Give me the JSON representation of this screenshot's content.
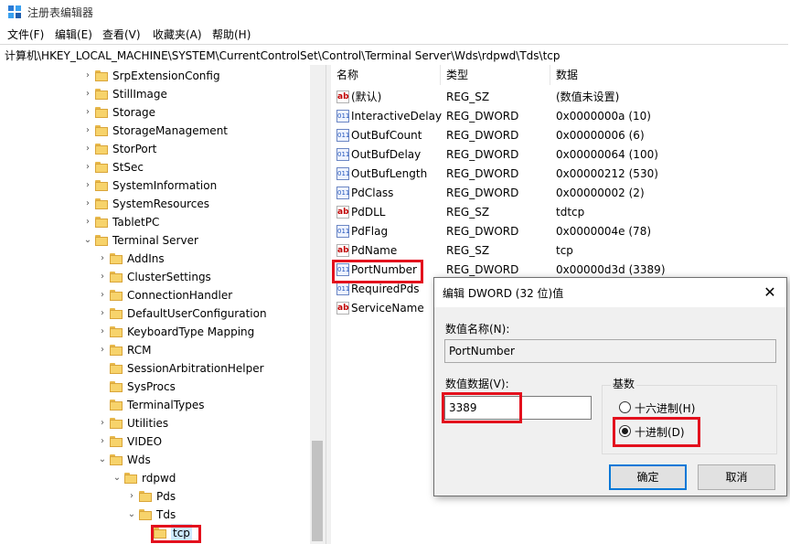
{
  "window": {
    "title": "注册表编辑器",
    "app_icon": "regedit-icon"
  },
  "menu": [
    "文件(F)",
    "编辑(E)",
    "查看(V)",
    "收藏夹(A)",
    "帮助(H)"
  ],
  "address": "计算机\\HKEY_LOCAL_MACHINE\\SYSTEM\\CurrentControlSet\\Control\\Terminal Server\\Wds\\rdpwd\\Tds\\tcp",
  "tree": [
    {
      "label": "SrpExtensionConfig",
      "level": 0,
      "expand": "collapsed"
    },
    {
      "label": "StillImage",
      "level": 0,
      "expand": "collapsed"
    },
    {
      "label": "Storage",
      "level": 0,
      "expand": "collapsed"
    },
    {
      "label": "StorageManagement",
      "level": 0,
      "expand": "collapsed"
    },
    {
      "label": "StorPort",
      "level": 0,
      "expand": "collapsed"
    },
    {
      "label": "StSec",
      "level": 0,
      "expand": "collapsed"
    },
    {
      "label": "SystemInformation",
      "level": 0,
      "expand": "collapsed"
    },
    {
      "label": "SystemResources",
      "level": 0,
      "expand": "collapsed"
    },
    {
      "label": "TabletPC",
      "level": 0,
      "expand": "collapsed"
    },
    {
      "label": "Terminal Server",
      "level": 0,
      "expand": "expanded"
    },
    {
      "label": "AddIns",
      "level": 1,
      "expand": "collapsed"
    },
    {
      "label": "ClusterSettings",
      "level": 1,
      "expand": "collapsed"
    },
    {
      "label": "ConnectionHandler",
      "level": 1,
      "expand": "collapsed"
    },
    {
      "label": "DefaultUserConfiguration",
      "level": 1,
      "expand": "collapsed"
    },
    {
      "label": "KeyboardType Mapping",
      "level": 1,
      "expand": "collapsed"
    },
    {
      "label": "RCM",
      "level": 1,
      "expand": "collapsed"
    },
    {
      "label": "SessionArbitrationHelper",
      "level": 1,
      "expand": "none"
    },
    {
      "label": "SysProcs",
      "level": 1,
      "expand": "none"
    },
    {
      "label": "TerminalTypes",
      "level": 1,
      "expand": "none"
    },
    {
      "label": "Utilities",
      "level": 1,
      "expand": "collapsed"
    },
    {
      "label": "VIDEO",
      "level": 1,
      "expand": "collapsed"
    },
    {
      "label": "Wds",
      "level": 1,
      "expand": "expanded"
    },
    {
      "label": "rdpwd",
      "level": 2,
      "expand": "expanded"
    },
    {
      "label": "Pds",
      "level": 3,
      "expand": "collapsed"
    },
    {
      "label": "Tds",
      "level": 3,
      "expand": "expanded"
    },
    {
      "label": "tcp",
      "level": 4,
      "expand": "none",
      "selected": true
    }
  ],
  "list": {
    "headers": {
      "name": "名称",
      "type": "类型",
      "data": "数据"
    },
    "rows": [
      {
        "name": "(默认)",
        "type": "REG_SZ",
        "data": "(数值未设置)",
        "icon": "string-value-icon"
      },
      {
        "name": "InteractiveDelay",
        "type": "REG_DWORD",
        "data": "0x0000000a (10)",
        "icon": "dword-value-icon"
      },
      {
        "name": "OutBufCount",
        "type": "REG_DWORD",
        "data": "0x00000006 (6)",
        "icon": "dword-value-icon"
      },
      {
        "name": "OutBufDelay",
        "type": "REG_DWORD",
        "data": "0x00000064 (100)",
        "icon": "dword-value-icon"
      },
      {
        "name": "OutBufLength",
        "type": "REG_DWORD",
        "data": "0x00000212 (530)",
        "icon": "dword-value-icon"
      },
      {
        "name": "PdClass",
        "type": "REG_DWORD",
        "data": "0x00000002 (2)",
        "icon": "dword-value-icon"
      },
      {
        "name": "PdDLL",
        "type": "REG_SZ",
        "data": "tdtcp",
        "icon": "string-value-icon"
      },
      {
        "name": "PdFlag",
        "type": "REG_DWORD",
        "data": "0x0000004e (78)",
        "icon": "dword-value-icon"
      },
      {
        "name": "PdName",
        "type": "REG_SZ",
        "data": "tcp",
        "icon": "string-value-icon"
      },
      {
        "name": "PortNumber",
        "type": "REG_DWORD",
        "data": "0x00000d3d (3389)",
        "icon": "dword-value-icon"
      },
      {
        "name": "RequiredPds",
        "type": "",
        "data": "",
        "icon": "dword-value-icon"
      },
      {
        "name": "ServiceName",
        "type": "",
        "data": "",
        "icon": "string-value-icon"
      }
    ]
  },
  "dialog": {
    "title": "编辑 DWORD (32 位)值",
    "name_label": "数值名称(N):",
    "name_value": "PortNumber",
    "data_label": "数值数据(V):",
    "data_value": "3389",
    "base_label": "基数",
    "hex_label": "十六进制(H)",
    "dec_label": "十进制(D)",
    "selected_base": "decimal",
    "ok_label": "确定",
    "cancel_label": "取消"
  },
  "highlight_color": "#e3101d"
}
